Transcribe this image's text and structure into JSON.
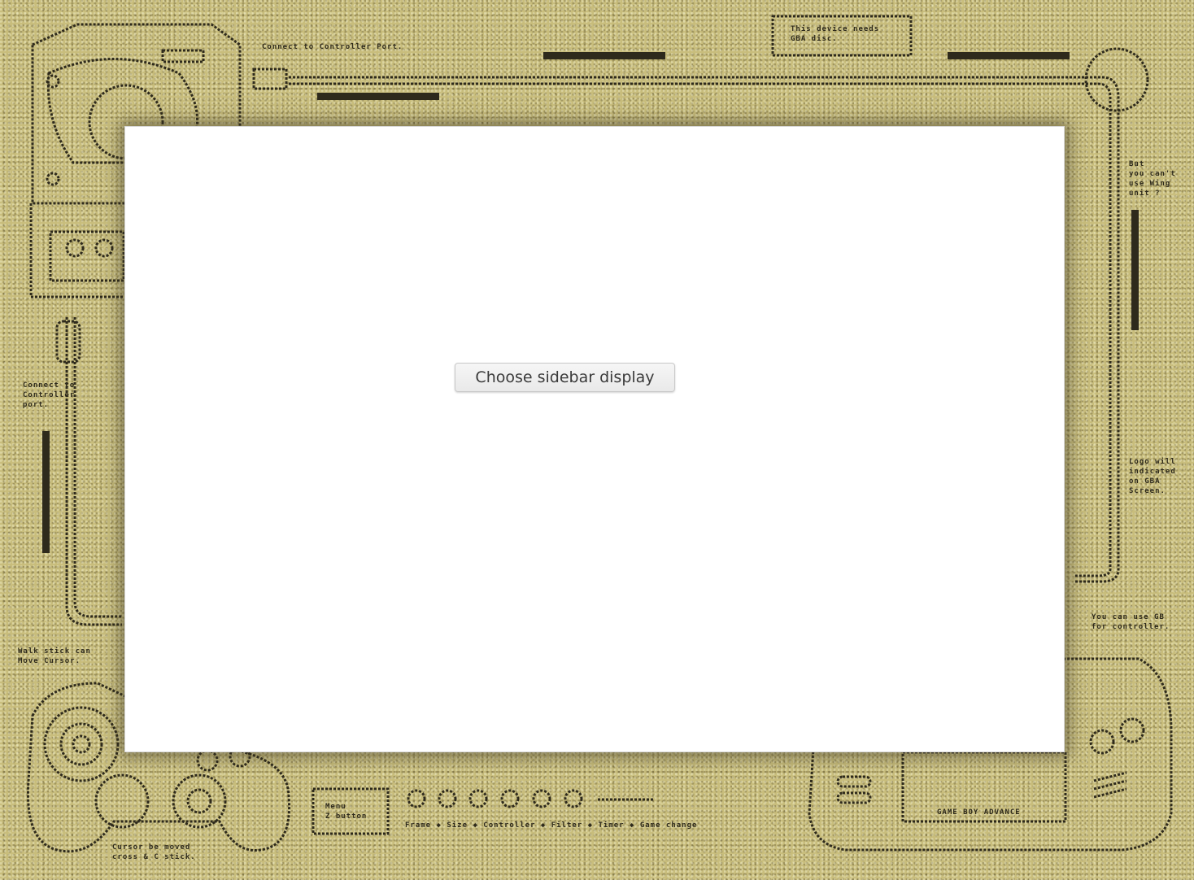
{
  "screen": {
    "button_label": "Choose sidebar display"
  },
  "frame": {
    "texture_color": "#c8bd7c",
    "line_color": "#2e2a1c",
    "notes": {
      "top_connect": "Connect to Controller Port.",
      "top_right_box": "This device needs\nGBA disc.",
      "right_upper": "But\nyou can't\nuse Wing\nunit ?",
      "left_middle": "Connect to\nController\nport.",
      "right_middle": "Logo will\nindicated\non GBA\nScreen.",
      "right_lower": "You can use GB\nfor controller.",
      "left_lower": "Walk stick can\nMove Cursor.",
      "bottom_controller": "Cursor be moved\ncross & C stick.",
      "bottom_box": "Menu\nZ button",
      "bottom_legend": "Frame ◆ Size ◆ Controller ◆ Filter ◆ Timer ◆ Game change",
      "gba_label": "GAME BOY ADVANCE"
    },
    "icons": [
      "gamecube-console-icon",
      "controller-port-cable-icon",
      "gamecube-controller-icon",
      "gameboy-advance-icon",
      "circle-dots-icon"
    ]
  }
}
